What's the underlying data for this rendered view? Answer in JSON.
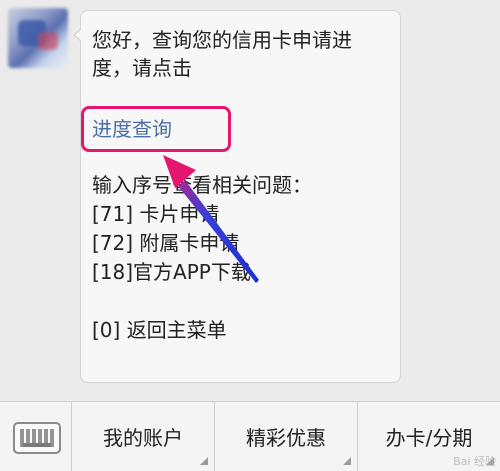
{
  "chat": {
    "message": {
      "line1": "您好，查询您的信用卡申请进",
      "line2": "度，请点击",
      "link": "进度查询",
      "prompt": "输入序号查看相关问题：",
      "options": [
        "[71] 卡片申请",
        "[72] 附属卡申请",
        "[18]官方APP下载"
      ],
      "back": "[0] 返回主菜单"
    }
  },
  "bottom_menu": {
    "keyboard_icon": "keyboard-icon",
    "items": [
      {
        "label": "我的账户"
      },
      {
        "label": "精彩优惠"
      },
      {
        "label": "办卡/分期"
      }
    ]
  },
  "annotation": {
    "box_color": "#e4166e",
    "arrow_color": "#1a2fd6"
  },
  "watermark": "Bai 经验"
}
